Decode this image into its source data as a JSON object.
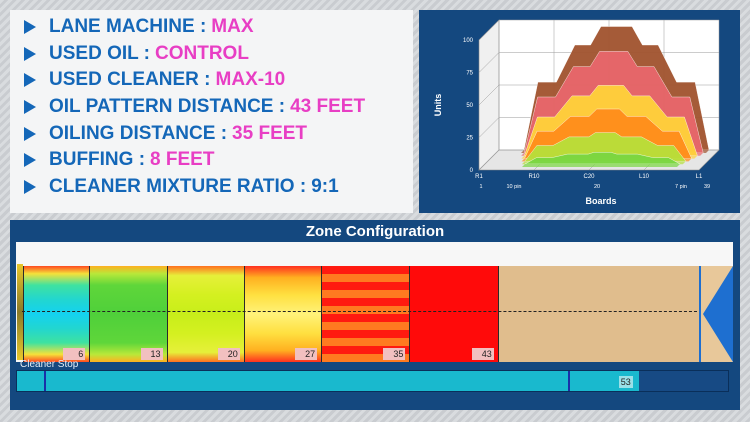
{
  "specs": [
    {
      "label": "LANE MACHINE :",
      "value": "MAX",
      "value_color": "pink"
    },
    {
      "label": "USED OIL :",
      "value": "CONTROL",
      "value_color": "pink"
    },
    {
      "label": "USED CLEANER :",
      "value": "MAX-10",
      "value_color": "pink"
    },
    {
      "label": "OIL PATTERN DISTANCE :",
      "value": "43 FEET",
      "value_color": "pink"
    },
    {
      "label": "OILING DISTANCE :",
      "value": "35 FEET",
      "value_color": "pink"
    },
    {
      "label": "BUFFING :",
      "value": "8 FEET",
      "value_color": "pink"
    },
    {
      "label": "CLEANER MIXTURE RATIO :",
      "value": "9:1",
      "value_color": "blue"
    }
  ],
  "colors": {
    "label_blue": "#1467b8",
    "value_pink": "#e83ec4",
    "panel_navy": "#14487f"
  },
  "chart_data": {
    "type": "area",
    "ylabel": "Units",
    "xlabel": "Boards",
    "ylim": [
      0,
      100
    ],
    "y_ticks": [
      "0",
      "25",
      "50",
      "75",
      "100"
    ],
    "x_ticks_top": [
      "R1",
      "R10",
      "C20",
      "L10",
      "L1"
    ],
    "x_ticks_bottom": [
      "1",
      "10 pin",
      "20",
      "7 pin",
      "39"
    ],
    "grid": true,
    "series": [
      {
        "color": "#a0522d",
        "peak": 95
      },
      {
        "color": "#e8676b",
        "peak": 78
      },
      {
        "color": "#ffd23a",
        "peak": 54
      },
      {
        "color": "#ff8c1a",
        "peak": 38
      },
      {
        "color": "#b7df3a",
        "peak": 22
      },
      {
        "color": "#79d640",
        "peak": 9
      }
    ]
  },
  "zone_config": {
    "title": "Zone Configuration",
    "zones": [
      {
        "label": "6",
        "end_feet": 6,
        "style": "cyan"
      },
      {
        "label": "13",
        "end_feet": 13,
        "style": "green"
      },
      {
        "label": "20",
        "end_feet": 20,
        "style": "lime"
      },
      {
        "label": "27",
        "end_feet": 27,
        "style": "yellow"
      },
      {
        "label": "35",
        "end_feet": 35,
        "style": "orange"
      },
      {
        "label": "43",
        "end_feet": 43,
        "style": "red"
      }
    ],
    "lane_length_feet": 60,
    "cleaner_stop_label": "Cleaner Stop",
    "cleaner_stop_value": "53",
    "cleaner_stop_feet": 53
  }
}
